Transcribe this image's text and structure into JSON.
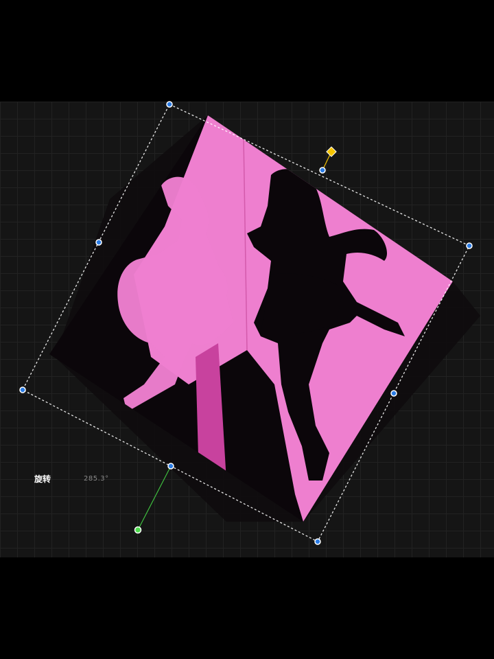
{
  "editor": {
    "rotation": {
      "label": "旋转",
      "value": "285.3°"
    }
  },
  "colors": {
    "background": "#000000",
    "canvas": "#151515",
    "image_pink": "#ee7fcf",
    "image_dark_pink": "#c8429e",
    "silhouette": "#0b060a",
    "handle_blue": "#2a7be4",
    "rotate_handle_yellow": "#f5c400",
    "pivot_green": "#4ddb4d",
    "pivot_line": "#3fbf3f",
    "bounding_box": "#ffffff"
  },
  "icons": {
    "corner_handle": "circle",
    "rotate_handle": "diamond",
    "pivot_handle": "circle"
  }
}
